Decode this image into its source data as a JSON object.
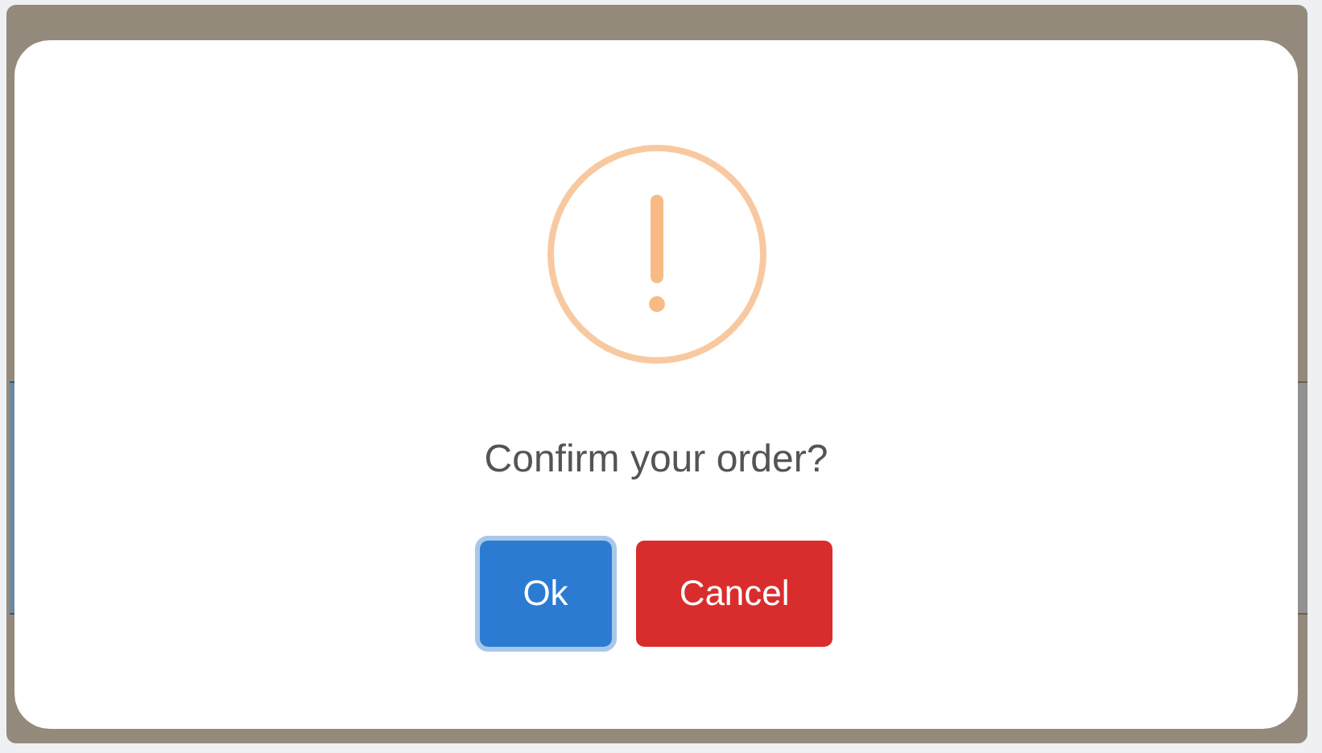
{
  "dialog": {
    "message": "Confirm your order?",
    "buttons": [
      {
        "label": "Ok",
        "kind": "confirm",
        "focused": true
      },
      {
        "label": "Cancel",
        "kind": "cancel",
        "focused": false
      }
    ]
  }
}
